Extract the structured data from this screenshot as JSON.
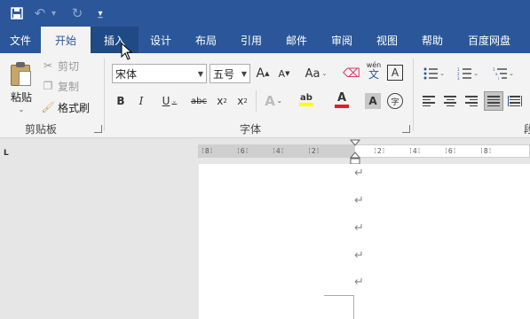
{
  "quick_access": {
    "save_icon": "save-icon",
    "undo_icon": "undo-icon",
    "redo_icon": "redo-icon",
    "customize_icon": "customize-icon"
  },
  "tabs": [
    {
      "label": "文件"
    },
    {
      "label": "开始"
    },
    {
      "label": "插入"
    },
    {
      "label": "设计"
    },
    {
      "label": "布局"
    },
    {
      "label": "引用"
    },
    {
      "label": "邮件"
    },
    {
      "label": "审阅"
    },
    {
      "label": "视图"
    },
    {
      "label": "帮助"
    },
    {
      "label": "百度网盘"
    }
  ],
  "clipboard": {
    "paste": "粘贴",
    "cut": "剪切",
    "copy": "复制",
    "format_painter": "格式刷",
    "group_label": "剪贴板"
  },
  "font": {
    "font_name": "宋体",
    "font_size": "五号",
    "grow": "A",
    "shrink": "A",
    "change_case": "Aa",
    "phonetic": "wén",
    "phonetic_char": "文",
    "char_border": "A",
    "bold": "B",
    "italic": "I",
    "underline": "U",
    "strike": "abc",
    "subscript": "x",
    "superscript": "x",
    "effects": "A",
    "highlight": "ab",
    "font_color": "A",
    "char_shading": "A",
    "enclose": "字",
    "group_label": "字体"
  },
  "paragraph": {
    "group_label_partial": "段"
  },
  "ruler": {
    "ticks": [
      "8",
      "6",
      "4",
      "2",
      "2",
      "4",
      "6",
      "8"
    ]
  },
  "document": {
    "paragraph_mark": "↵"
  },
  "colors": {
    "title_bar": "#2b579a",
    "highlight_yellow": "#ffff00",
    "font_red": "#e02020"
  }
}
